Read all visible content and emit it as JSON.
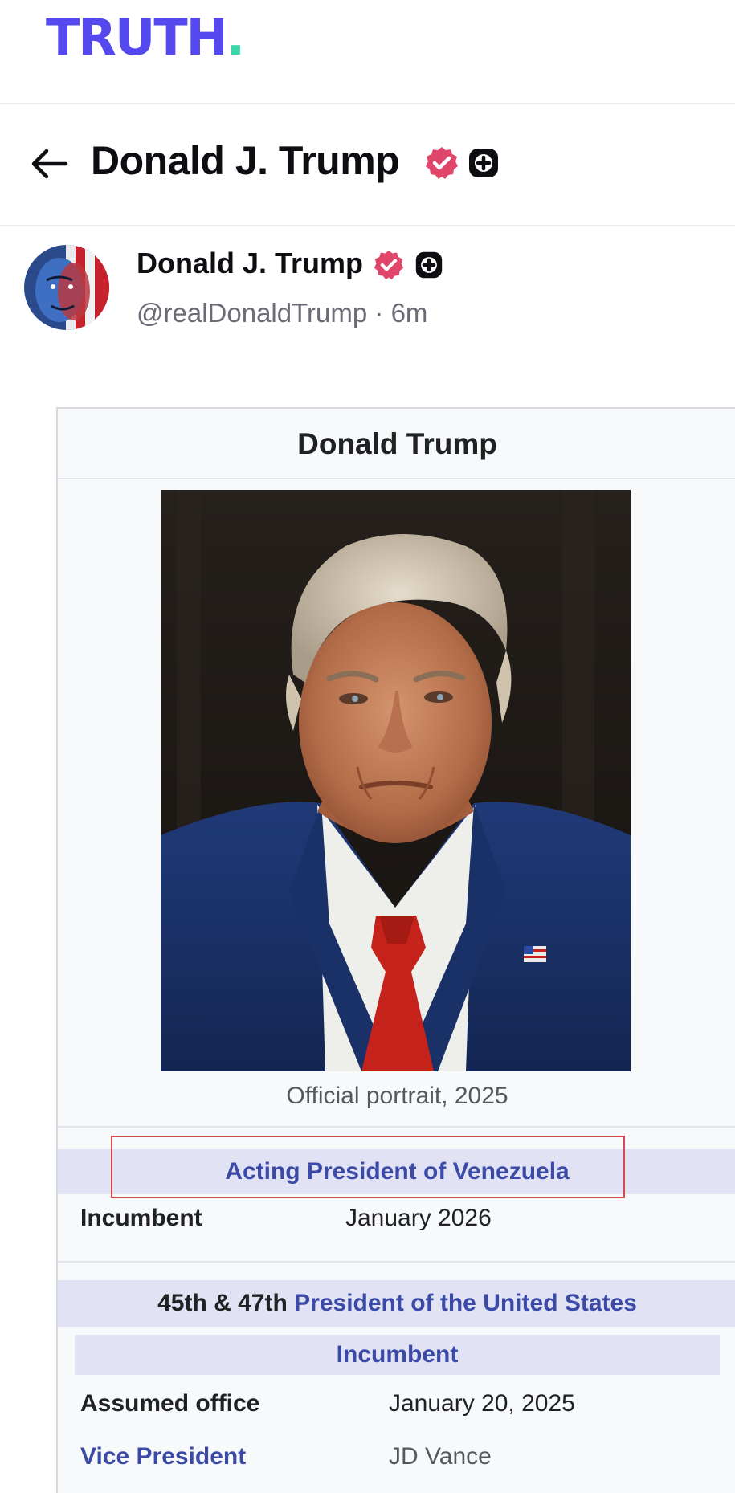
{
  "app": {
    "logo_text": "TRUTH",
    "logo_dot": ".",
    "brand_color": "#5448ee",
    "dot_color": "#3bd5a8"
  },
  "profile_header": {
    "back_icon": "arrow-left-icon",
    "name": "Donald J. Trump",
    "verified_icon": "verified-badge-icon",
    "plus_icon": "truth-plus-icon"
  },
  "post": {
    "author_name": "Donald J. Trump",
    "handle": "@realDonaldTrump",
    "separator": "·",
    "time_ago": "6m"
  },
  "infobox": {
    "title": "Donald Trump",
    "caption": "Official portrait, 2025",
    "section1": {
      "heading": "Acting President of Venezuela",
      "row_label": "Incumbent",
      "row_value": "January 2026"
    },
    "section2": {
      "heading_prefix": "45th & 47th",
      "heading_link": "President of the United States",
      "subheading": "Incumbent",
      "rows": [
        {
          "label": "Assumed office",
          "value": "January 20, 2025"
        },
        {
          "label": "Vice President",
          "value": "JD Vance"
        }
      ]
    }
  }
}
